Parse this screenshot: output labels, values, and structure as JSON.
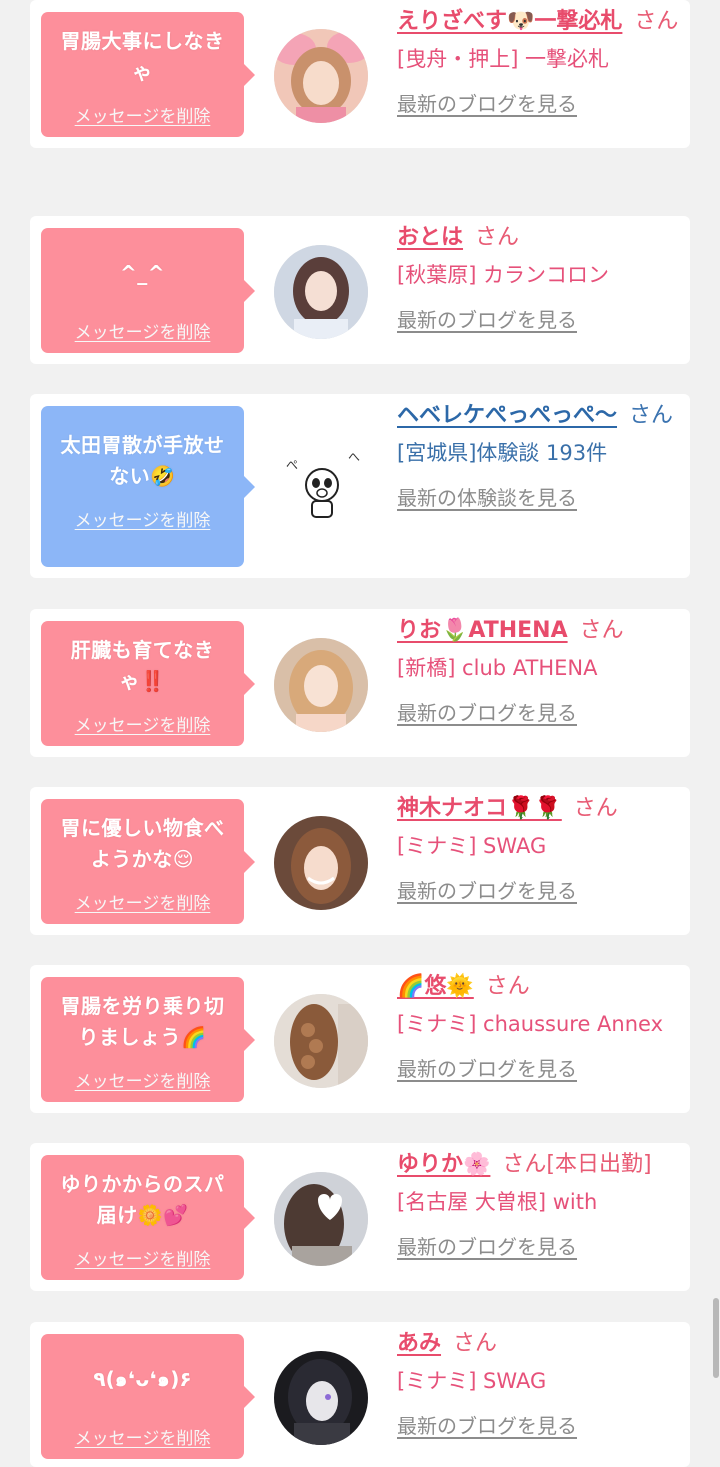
{
  "cards": [
    {
      "bubble_color": "pink",
      "message": "胃腸大事にしなきゃ",
      "delete_label": "メッセージを削除",
      "name": "えりざべす🐶一撃必札",
      "san": "さん",
      "shop": "[曳舟・押上] 一撃必札",
      "link": "最新のブログを見る",
      "theme": "pink"
    },
    {
      "bubble_color": "pink",
      "message": "^_^",
      "delete_label": "メッセージを削除",
      "name": "おとは",
      "san": "さん",
      "shop": "[秋葉原] カランコロン",
      "link": "最新のブログを見る",
      "theme": "pink"
    },
    {
      "bubble_color": "blue",
      "message": "太田胃散が手放せない🤣",
      "delete_label": "メッセージを削除",
      "name": "ヘベレケぺっぺっぺ〜",
      "san": "さん",
      "shop": "[宮城県]体験談 193件",
      "link": "最新の体験談を見る",
      "theme": "blue"
    },
    {
      "bubble_color": "pink",
      "message": "肝臓も育てなきゃ‼️",
      "delete_label": "メッセージを削除",
      "name": "りお🌷ATHENA",
      "san": "さん",
      "shop": "[新橋] club ATHENA",
      "link": "最新のブログを見る",
      "theme": "pink"
    },
    {
      "bubble_color": "pink",
      "message": "胃に優しい物食べようかな😌",
      "delete_label": "メッセージを削除",
      "name": "神木ナオコ🌹🌹",
      "san": "さん",
      "shop": "[ミナミ] SWAG",
      "link": "最新のブログを見る",
      "theme": "pink"
    },
    {
      "bubble_color": "pink",
      "message": "胃腸を労り乗り切りましょう🌈",
      "delete_label": "メッセージを削除",
      "name": "🌈悠🌞",
      "san": "さん",
      "shop": "[ミナミ] chaussure Annex",
      "link": "最新のブログを見る",
      "theme": "pink"
    },
    {
      "bubble_color": "pink",
      "message": "ゆりかからのスパ届け🌼💕",
      "delete_label": "メッセージを削除",
      "name": "ゆりか🌸",
      "san": "さん[本日出勤]",
      "shop": "[名古屋 大曽根] with",
      "link": "最新のブログを見る",
      "theme": "pink"
    },
    {
      "bubble_color": "pink",
      "message": "٩(๑❛ᴗ❛๑)۶",
      "delete_label": "メッセージを削除",
      "name": "あみ",
      "san": "さん",
      "shop": "[ミナミ] SWAG",
      "link": "最新のブログを見る",
      "theme": "pink"
    }
  ],
  "colors": {
    "background": "#f1f1f1",
    "pink_bubble": "#fd8f9b",
    "blue_bubble": "#8cb6f7",
    "name_pink": "#e84c6c",
    "name_blue": "#2c68a8",
    "link_gray": "#8c8c8c"
  }
}
